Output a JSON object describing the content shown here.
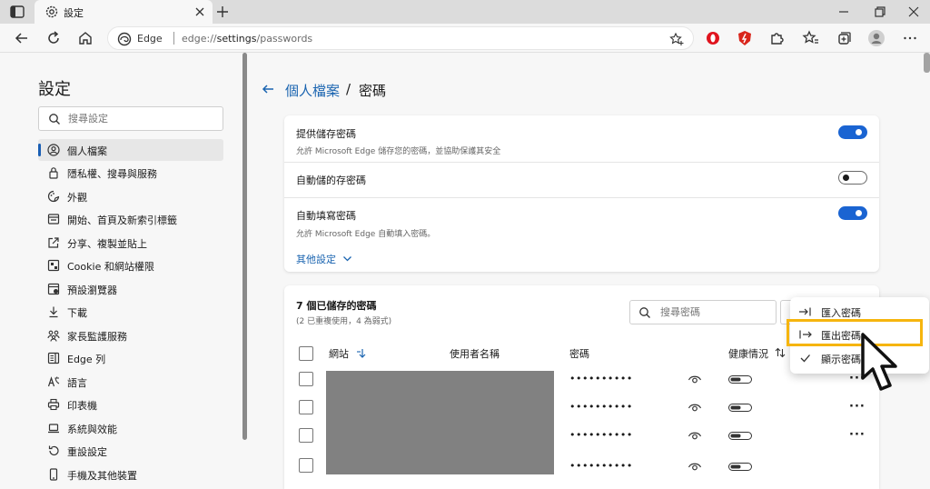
{
  "browser": {
    "tab_title": "設定",
    "omnibox_site": "Edge",
    "url_prefix": "edge://",
    "url_host": "settings",
    "url_path": "/passwords"
  },
  "sidebar": {
    "title": "設定",
    "search_placeholder": "搜尋設定",
    "items": [
      {
        "label": "個人檔案",
        "icon": "profile-icon"
      },
      {
        "label": "隱私權、搜尋與服務",
        "icon": "lock-icon"
      },
      {
        "label": "外觀",
        "icon": "appearance-icon"
      },
      {
        "label": "開始、首頁及新索引標籤",
        "icon": "home-icon"
      },
      {
        "label": "分享、複製並貼上",
        "icon": "share-icon"
      },
      {
        "label": "Cookie 和網站權限",
        "icon": "cookie-icon"
      },
      {
        "label": "預設瀏覽器",
        "icon": "browser-icon"
      },
      {
        "label": "下載",
        "icon": "download-icon"
      },
      {
        "label": "家長監護服務",
        "icon": "family-icon"
      },
      {
        "label": "Edge 列",
        "icon": "edge-bar-icon"
      },
      {
        "label": "語言",
        "icon": "language-icon"
      },
      {
        "label": "印表機",
        "icon": "printer-icon"
      },
      {
        "label": "系統與效能",
        "icon": "laptop-icon"
      },
      {
        "label": "重設設定",
        "icon": "reset-icon"
      },
      {
        "label": "手機及其他裝置",
        "icon": "phone-icon"
      }
    ]
  },
  "breadcrumb": {
    "parent": "個人檔案",
    "separator": "/",
    "current": "密碼"
  },
  "settings": {
    "offer_save": {
      "title": "提供儲存密碼",
      "desc": "允許 Microsoft Edge 儲存您的密碼，並協助保護其安全",
      "on": true
    },
    "auto_save": {
      "title": "自動儲的存密碼",
      "on": false
    },
    "autofill": {
      "title": "自動填寫密碼",
      "desc": "允許 Microsoft Edge 自動填入密碼。",
      "on": true
    },
    "more_settings": "其他設定"
  },
  "passwords": {
    "count_title": "7 個已儲存的密碼",
    "sub": "(2 已重複使用，4 為弱式)",
    "search_placeholder": "搜尋密碼",
    "columns": {
      "site": "網站",
      "username": "使用者名稱",
      "password": "密碼",
      "health": "健康情況"
    },
    "rows": [
      {
        "password": "••••••••••"
      },
      {
        "password": "••••••••••"
      },
      {
        "password": "••••••••••"
      },
      {
        "password": "••••••••••"
      }
    ],
    "row_more": "···"
  },
  "menu": {
    "items": [
      {
        "label": "匯入密碼",
        "icon": "import-icon"
      },
      {
        "label": "匯出密碼",
        "icon": "export-icon"
      },
      {
        "label": "顯示密碼",
        "icon": "check-icon"
      }
    ]
  },
  "colors": {
    "accent": "#1a64d2",
    "link": "#1a64b0",
    "highlight": "#f6b50e",
    "redaction": "#818181"
  }
}
